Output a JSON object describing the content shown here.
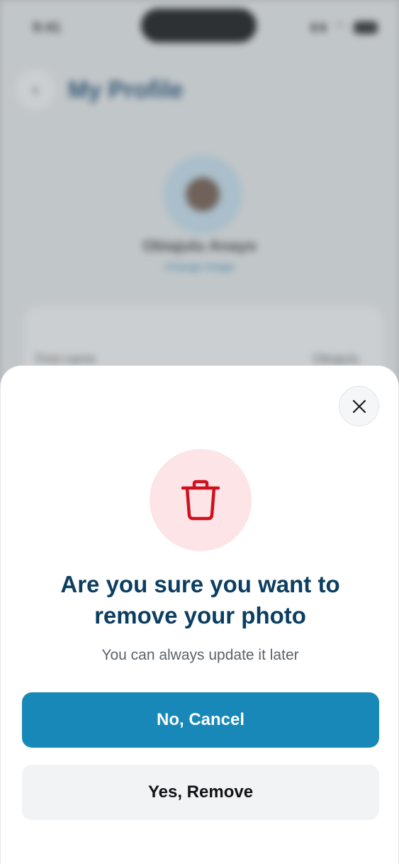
{
  "background": {
    "status_time": "9:41",
    "page_title": "My Profile",
    "profile_name": "Obiajulu Anayo",
    "change_link": "Change Image",
    "info_label": "First name",
    "info_value": "Obiajulu"
  },
  "dialog": {
    "close_icon": "close-icon",
    "trash_icon": "trash-icon",
    "title": "Are you sure you want to remove your photo",
    "subtitle": "You can always update it later",
    "cancel_label": "No, Cancel",
    "remove_label": "Yes, Remove"
  },
  "colors": {
    "primary": "#1788b7",
    "title": "#0c3e61",
    "danger": "#d0101f",
    "danger_bg": "#fde4e6"
  }
}
